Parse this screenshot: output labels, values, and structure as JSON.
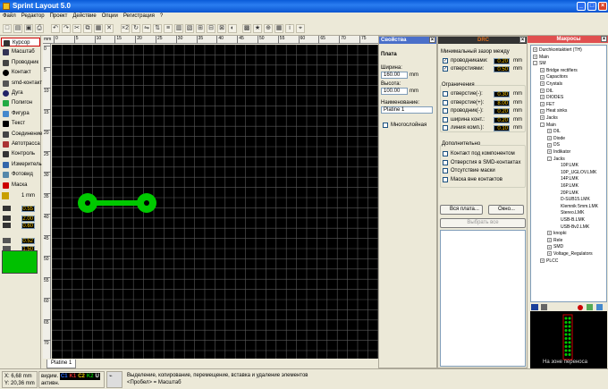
{
  "app": {
    "title": "Sprint Layout 5.0"
  },
  "menu": [
    "Файл",
    "Редактор",
    "Проект",
    "Действие",
    "Опции",
    "Регистрация",
    "?"
  ],
  "tools": [
    {
      "label": "Курсор",
      "icon": "cursor-icon",
      "selected": true
    },
    {
      "label": "Масштаб",
      "icon": "zoom-icon"
    },
    {
      "label": "Проводник",
      "icon": "track-icon"
    },
    {
      "label": "Контакт",
      "icon": "pad-icon"
    },
    {
      "label": "smd-контакт",
      "icon": "smd-pad-icon"
    },
    {
      "label": "Дуга",
      "icon": "arc-icon"
    },
    {
      "label": "Полигон",
      "icon": "polygon-icon"
    },
    {
      "label": "Фигура",
      "icon": "shape-icon"
    },
    {
      "label": "Текст",
      "icon": "text-icon"
    },
    {
      "label": "Соединение",
      "icon": "connection-icon"
    },
    {
      "label": "Автотрасса",
      "icon": "autoroute-icon"
    },
    {
      "label": "Контроль",
      "icon": "check-icon"
    },
    {
      "label": "Измеритель",
      "icon": "measure-icon"
    },
    {
      "label": "Фотовид",
      "icon": "photo-view-icon"
    },
    {
      "label": "Маска",
      "icon": "mask-icon"
    }
  ],
  "grid": {
    "label": "1 mm"
  },
  "track_widths": {
    "w1": "0.55",
    "w2": "2.00",
    "w3": "0.60",
    "w4": "0.52",
    "w5": "1.50"
  },
  "ruler": {
    "top_unit": "mm",
    "top_ticks": [
      "0",
      "5",
      "10",
      "15",
      "20",
      "25",
      "30",
      "35",
      "40",
      "45",
      "50",
      "55",
      "60",
      "65",
      "70",
      "75"
    ],
    "left_ticks": [
      "0",
      "5",
      "10",
      "15",
      "20",
      "25",
      "30",
      "35",
      "40",
      "45",
      "50",
      "55",
      "60",
      "65",
      "70"
    ]
  },
  "board_tab": "Platine 1",
  "props": {
    "header": "Свойства",
    "section": "Плата",
    "width_label": "Ширина:",
    "width_value": "160.00",
    "width_unit": "mm",
    "height_label": "Высота:",
    "height_value": "100.00",
    "height_unit": "mm",
    "name_label": "Наименование:",
    "name_value": "Platine 1",
    "multilayer_label": "Многослойная"
  },
  "drc": {
    "header": "DRC",
    "min_gap_label": "Минимальный зазор между",
    "gap_items": [
      {
        "label": "проводниками:",
        "value": "0.20",
        "unit": "mm",
        "checked": true
      },
      {
        "label": "отверстиями:",
        "value": "0.50",
        "unit": "mm",
        "checked": true
      }
    ],
    "limits_label": "Ограничения",
    "limit_items": [
      {
        "label": "отверстие(-):",
        "value": "0.30",
        "unit": "mm"
      },
      {
        "label": "отверстие(+):",
        "value": "8.00",
        "unit": "mm"
      },
      {
        "label": "проводник(-):",
        "value": "0.20",
        "unit": "mm"
      },
      {
        "label": "ширина конт.:",
        "value": "0.20",
        "unit": "mm"
      },
      {
        "label": "линия комп.):",
        "value": "0.10",
        "unit": "mm"
      }
    ],
    "extra_label": "Дополнительно",
    "extra_items": [
      "Контакт под компонентом",
      "Отверстия в SMD-контактах",
      "Отсутствие маски",
      "Маска вне контактов"
    ],
    "btn_all": "Вся плата...",
    "btn_window": "Окно...",
    "btn_select": "Выбрать все"
  },
  "macro": {
    "header": "Макросы",
    "tree": [
      {
        "t": "Durchkontaktiert (TH)",
        "d": 0,
        "pm": "+"
      },
      {
        "t": "Main",
        "d": 0,
        "pm": "+"
      },
      {
        "t": "SM",
        "d": 0,
        "pm": "-"
      },
      {
        "t": "Bridge rectifiers",
        "d": 1,
        "pm": "+"
      },
      {
        "t": "Capacitors",
        "d": 1,
        "pm": "+"
      },
      {
        "t": "Crystals",
        "d": 1,
        "pm": "+"
      },
      {
        "t": "DIL",
        "d": 1,
        "pm": "+"
      },
      {
        "t": "DIODES",
        "d": 1,
        "pm": "+"
      },
      {
        "t": "FET",
        "d": 1,
        "pm": "+"
      },
      {
        "t": "Heat sinks",
        "d": 1,
        "pm": "+"
      },
      {
        "t": "Jacks",
        "d": 1,
        "pm": "+"
      },
      {
        "t": "Main",
        "d": 1,
        "pm": "-"
      },
      {
        "t": "DIL",
        "d": 2,
        "pm": "+"
      },
      {
        "t": "Diode",
        "d": 2,
        "pm": "+"
      },
      {
        "t": "DS",
        "d": 2,
        "pm": "+"
      },
      {
        "t": "Indikator",
        "d": 2,
        "pm": "+"
      },
      {
        "t": "Jacks",
        "d": 2,
        "pm": "-"
      },
      {
        "t": "10P.LMK",
        "d": 3
      },
      {
        "t": "10P_UGLOV.LMK",
        "d": 3
      },
      {
        "t": "14P.LMK",
        "d": 3
      },
      {
        "t": "16P.LMK",
        "d": 3
      },
      {
        "t": "20P.LMK",
        "d": 3
      },
      {
        "t": "D-SUB15.LMK",
        "d": 3
      },
      {
        "t": "Klemnik 5mm.LMK",
        "d": 3
      },
      {
        "t": "Stereo.LMK",
        "d": 3
      },
      {
        "t": "USB-B.LMK",
        "d": 3
      },
      {
        "t": "USB-Bv2.LMK",
        "d": 3
      },
      {
        "t": "knopki",
        "d": 2,
        "pm": "+"
      },
      {
        "t": "Rele",
        "d": 2,
        "pm": "+"
      },
      {
        "t": "SMD",
        "d": 2,
        "pm": "+"
      },
      {
        "t": "Voltage_Regulators",
        "d": 2,
        "pm": "+"
      },
      {
        "t": "PLCC",
        "d": 1,
        "pm": "+"
      }
    ],
    "preview_text": "На зоне переносa"
  },
  "status": {
    "x_label": "X:",
    "x_value": "6,68 mm",
    "y_label": "Y:",
    "y_value": "20,36 mm",
    "visible_label": "видим.",
    "active_label": "активн.",
    "layers": [
      "C1",
      "K1",
      "C2",
      "K2",
      "U"
    ],
    "hint1": "Выделение, копирование, перемещение, вставка и удаление элементов",
    "hint2": "<Пробел> = Масштаб"
  },
  "colors": {
    "accent": "#0a5bd8",
    "copper": "#00c800",
    "canvas": "#000000",
    "grid": "#5a5a5a"
  }
}
